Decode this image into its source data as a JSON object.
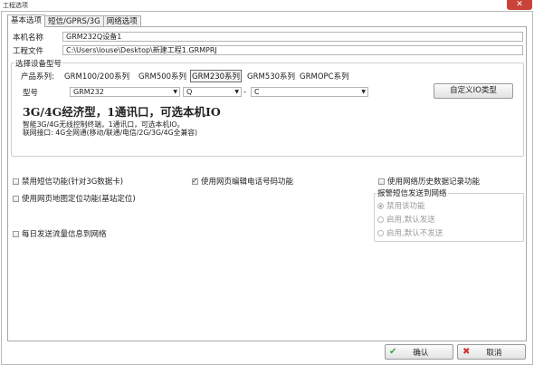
{
  "window": {
    "title": "工程选项",
    "close_glyph": "✕"
  },
  "tabs": [
    {
      "label": "基本选项",
      "active": true
    },
    {
      "label": "短信/GPRS/3G",
      "active": false
    },
    {
      "label": "网络选项",
      "active": false
    }
  ],
  "basic": {
    "machine_name_label": "本机名称",
    "machine_name_value": "GRM232Q设备1",
    "project_file_label": "工程文件",
    "project_file_value": "C:\\Users\\louse\\Desktop\\新建工程1.GRMPRJ"
  },
  "model_group": {
    "title": "选择设备型号",
    "series_label": "产品系列:",
    "series": [
      "GRM100/200系列",
      "GRM500系列",
      "GRM230系列",
      "GRM530系列",
      "GRMOPC系列"
    ],
    "selected_series": "GRM230系列",
    "model_label": "型号",
    "model_value": "GRM232",
    "variant_value": "Q",
    "separator": "-",
    "suffix_value": "C",
    "custom_io_button": "自定义IO类型",
    "headline": "3G/4G经济型，1通讯口，可选本机IO",
    "desc_line1": "智能3G/4G无线控制终端，1通讯口，可选本机IO。",
    "desc_line2": "联网接口: 4G全网通(移动/联通/电信/2G/3G/4G全兼容)"
  },
  "options": {
    "sms_label": "禁用短信功能(针对3G数据卡)",
    "sms_checked": false,
    "web_phone_label": "使用网页编辑电话号码功能",
    "web_phone_checked": true,
    "net_history_label": "使用网络历史数据记录功能",
    "net_history_checked": false,
    "web_map_label": "使用网页地图定位功能(基站定位)",
    "web_map_checked": false,
    "daily_traffic_label": "每日发送流量信息到网络",
    "daily_traffic_checked": false
  },
  "alarm_group": {
    "title": "报警短信发送到网络",
    "options": [
      "禁用该功能",
      "启用,默认发送",
      "启用,默认不发送"
    ],
    "selected_index": 0
  },
  "footer": {
    "ok_label": "确认",
    "cancel_label": "取消",
    "ok_icon": "check-icon",
    "cancel_icon": "cross-icon"
  },
  "colors": {
    "close_button": "#c9433a",
    "ok_icon": "#3aa63a",
    "cancel_icon": "#d03030"
  }
}
